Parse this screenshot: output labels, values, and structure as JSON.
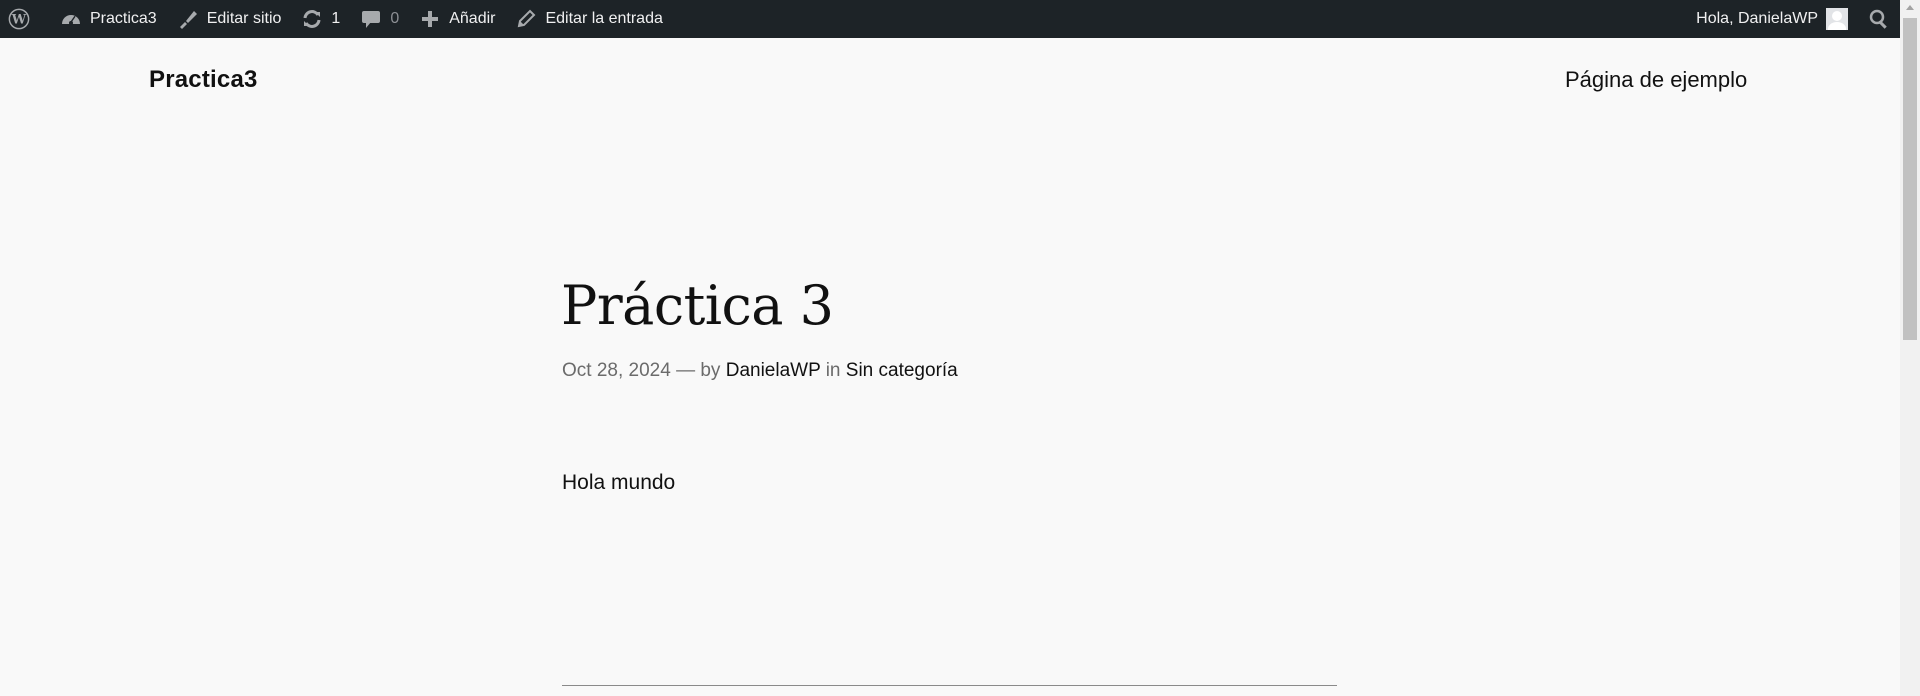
{
  "adminbar": {
    "site_name": "Practica3",
    "edit_site": "Editar sitio",
    "updates_count": "1",
    "comments_count": "0",
    "add_new": "Añadir",
    "edit_post": "Editar la entrada",
    "greeting": "Hola, DanielaWP"
  },
  "header": {
    "site_title": "Practica3",
    "nav_items": [
      "Página de ejemplo"
    ]
  },
  "post": {
    "title": "Práctica 3",
    "date": "Oct 28, 2024",
    "by_prefix": "— by",
    "author": "DanielaWP",
    "in_word": "in",
    "category": "Sin categoría",
    "content": "Hola mundo"
  },
  "icons": {
    "wordpress": "wordpress-logo-icon",
    "dashboard": "dashboard-gauge-icon",
    "customize": "paint-brush-icon",
    "updates": "refresh-icon",
    "comments": "speech-bubble-icon",
    "add": "plus-icon",
    "edit": "pencil-icon",
    "search": "search-icon"
  },
  "colors": {
    "adminbar_bg": "#1d2327",
    "page_bg": "#f9f9f9",
    "text": "#111111",
    "meta_text": "#6b6b6b"
  }
}
